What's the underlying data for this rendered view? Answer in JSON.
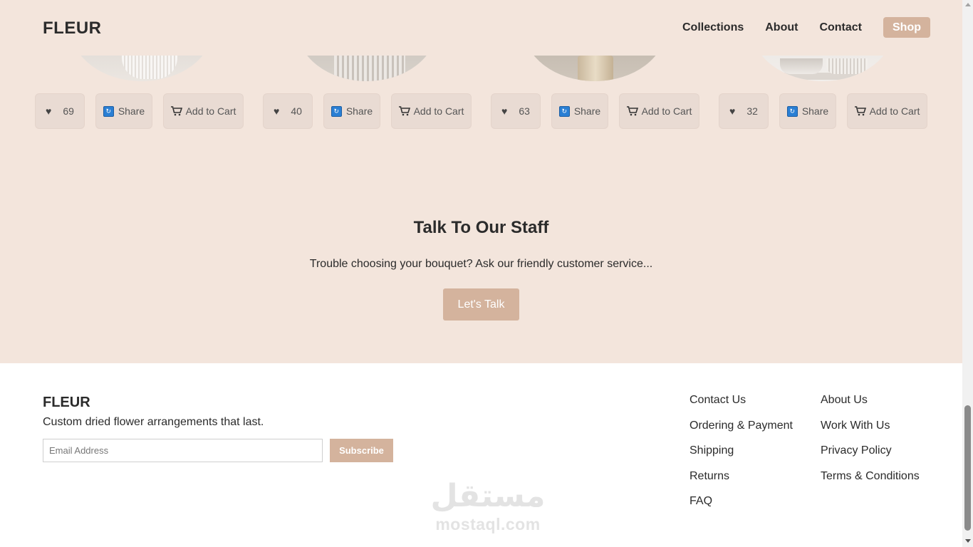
{
  "header": {
    "logo": "FLEUR",
    "nav": [
      "Collections",
      "About",
      "Contact"
    ],
    "shop_label": "Shop"
  },
  "products": [
    {
      "likes": "69",
      "share_label": "Share",
      "cart_label": "Add to Cart",
      "like_icon": "heart-icon",
      "share_icon": "share-icon",
      "cart_icon": "cart-icon"
    },
    {
      "likes": "40",
      "share_label": "Share",
      "cart_label": "Add to Cart",
      "like_icon": "heart-icon",
      "share_icon": "share-icon",
      "cart_icon": "cart-icon"
    },
    {
      "likes": "63",
      "share_label": "Share",
      "cart_label": "Add to Cart",
      "like_icon": "heart-icon",
      "share_icon": "share-icon",
      "cart_icon": "cart-icon"
    },
    {
      "likes": "32",
      "share_label": "Share",
      "cart_label": "Add to Cart",
      "like_icon": "heart-icon",
      "share_icon": "share-icon",
      "cart_icon": "cart-icon"
    }
  ],
  "talk": {
    "title": "Talk To Our Staff",
    "text": "Trouble choosing your bouquet? Ask our friendly customer service...",
    "button": "Let's Talk"
  },
  "footer": {
    "logo": "FLEUR",
    "tagline": "Custom dried flower arrangements that last.",
    "email_placeholder": "Email Address",
    "subscribe": "Subscribe",
    "col1": [
      "Contact Us",
      "Ordering & Payment",
      "Shipping",
      "Returns",
      "FAQ"
    ],
    "col2": [
      "About Us",
      "Work With Us",
      "Privacy Policy",
      "Terms & Conditions"
    ]
  },
  "watermark": {
    "arabic": "مستقل",
    "latin": "mostaql.com"
  },
  "colors": {
    "background": "#f3e5dc",
    "accent": "#d4b39d",
    "button_bg": "#e9dbd3",
    "text": "#2b2b2b"
  }
}
